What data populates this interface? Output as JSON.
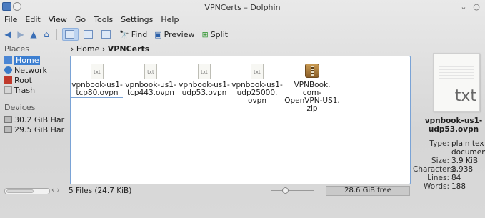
{
  "window": {
    "title": "VPNCerts – Dolphin"
  },
  "menu": [
    "File",
    "Edit",
    "View",
    "Go",
    "Tools",
    "Settings",
    "Help"
  ],
  "toolbar": {
    "find_label": "Find",
    "preview_label": "Preview",
    "split_label": "Split"
  },
  "places": {
    "title": "Places",
    "items": [
      {
        "label": "Home",
        "icon": "home-folder-icon",
        "active": true
      },
      {
        "label": "Network",
        "icon": "network-icon"
      },
      {
        "label": "Root",
        "icon": "root-folder-icon"
      },
      {
        "label": "Trash",
        "icon": "trash-icon"
      }
    ],
    "devices_title": "Devices",
    "devices": [
      {
        "label": "30.2 GiB Har",
        "icon": "hard-drive-icon"
      },
      {
        "label": "29.5 GiB Har",
        "icon": "hard-drive-icon"
      }
    ]
  },
  "breadcrumb": {
    "sep": "›",
    "parent": "Home",
    "current": "VPNCerts"
  },
  "files": [
    {
      "name": "vpnbook-us1-\ntcp80.ovpn",
      "icon_text": "txt"
    },
    {
      "name": "vpnbook-us1-\ntcp443.ovpn",
      "icon_text": "txt"
    },
    {
      "name": "vpnbook-us1-\nudp53.ovpn",
      "icon_text": "txt"
    },
    {
      "name": "vpnbook-us1-\nudp25000.\novpn",
      "icon_text": "txt"
    },
    {
      "name": "VPNBook.\ncom-\nOpenVPN-US1.\nzip",
      "icon_text": ""
    }
  ],
  "info": {
    "preview_text": "txt",
    "name": "vpnbook-us1-\nudp53.ovpn",
    "props": [
      {
        "k": "Type:",
        "v": "plain tex"
      },
      {
        "k": "",
        "v": "documen"
      },
      {
        "k": "Size:",
        "v": "3.9 KiB"
      },
      {
        "k": "Characters:",
        "v": "3,938"
      },
      {
        "k": "Lines:",
        "v": "84"
      },
      {
        "k": "Words:",
        "v": "188"
      }
    ]
  },
  "status": {
    "text": "5 Files (24.7 KiB)",
    "free": "28.6 GiB free"
  },
  "colors": {
    "accent": "#3d7fd1",
    "view_border": "#7aa3d6"
  }
}
